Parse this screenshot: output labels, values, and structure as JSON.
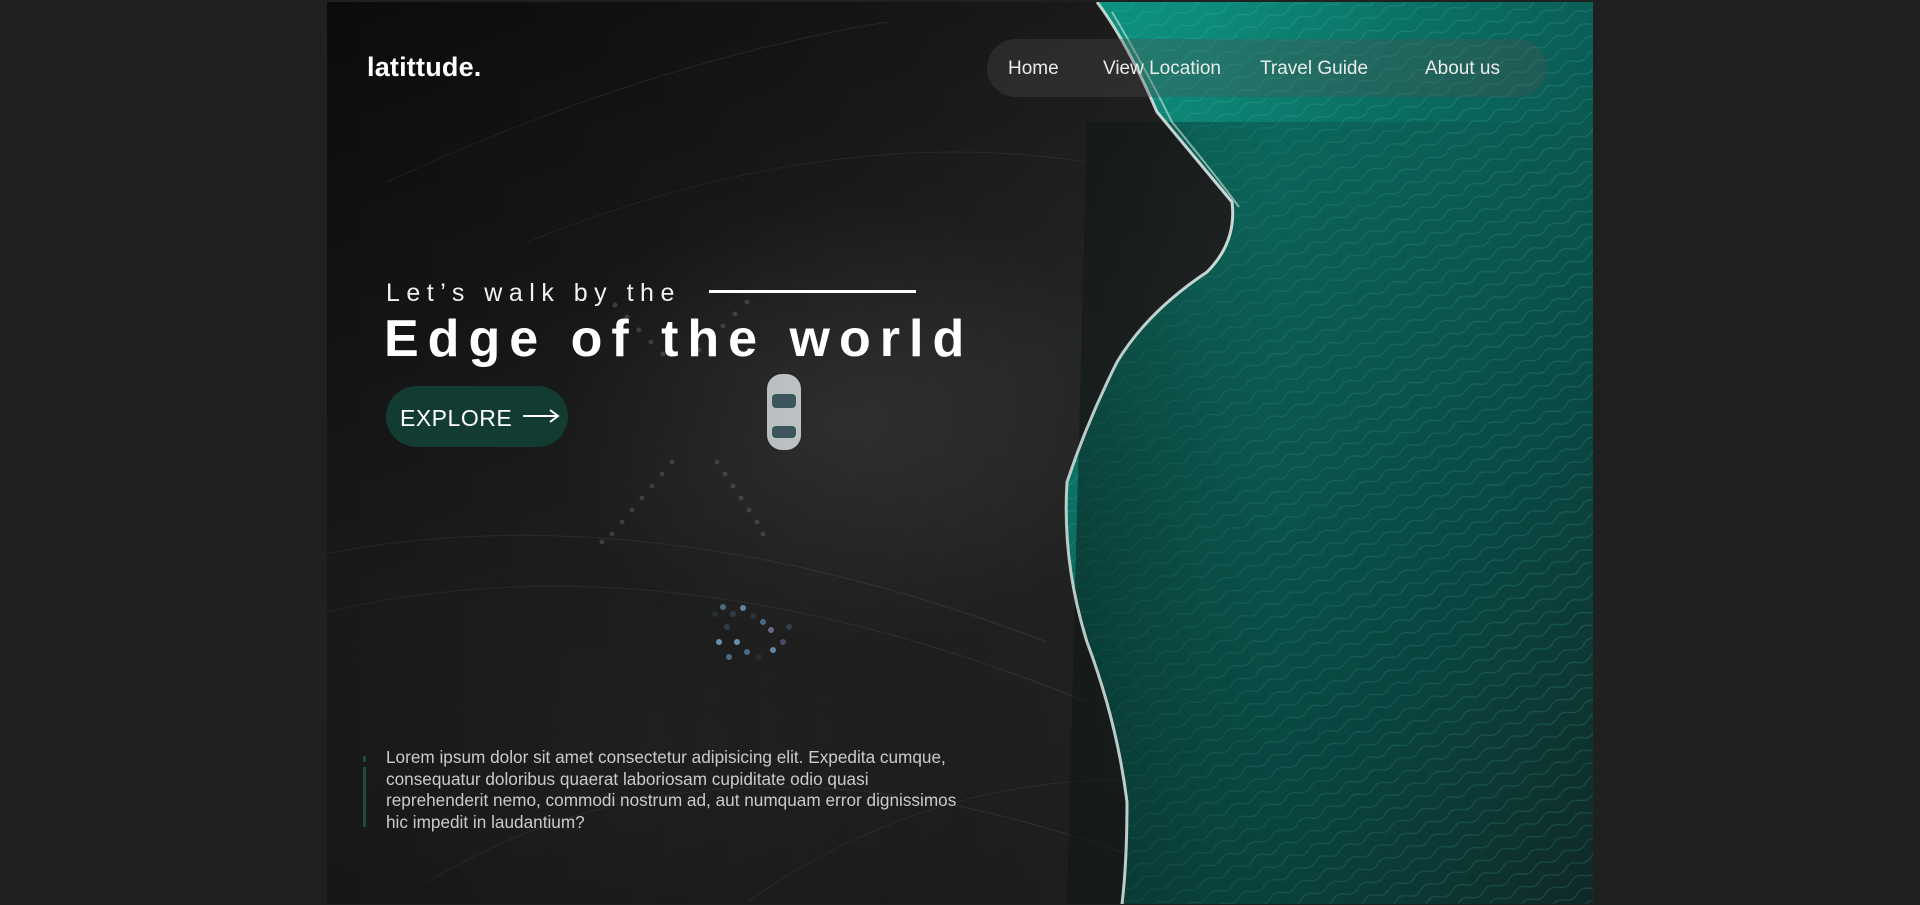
{
  "brand": {
    "logo_text": "latittude."
  },
  "nav": {
    "items": [
      {
        "label": "Home"
      },
      {
        "label": "View Location"
      },
      {
        "label": "Travel Guide"
      },
      {
        "label": "About us"
      }
    ]
  },
  "hero": {
    "tagline": "Let’s walk by the",
    "headline": "Edge of the world",
    "cta_label": "EXPLORE",
    "cta_icon": "arrow-right-icon"
  },
  "footer_text": {
    "paragraph": "Lorem ipsum dolor sit amet consectetur adipisicing elit. Expedita cumque, consequatur doloribus quaerat laboriosam cupiditate odio quasi reprehenderit nemo, commodi nostrum ad, aut numquam error dignissimos hic impedit in laudantium?"
  },
  "colors": {
    "page_background": "#1f2120",
    "button": "#123c32",
    "accent_bar": "#1b4d3e",
    "sea": "#0f8a7a"
  },
  "background_image": "aerial-black-sand-beach-with-turquoise-sea"
}
